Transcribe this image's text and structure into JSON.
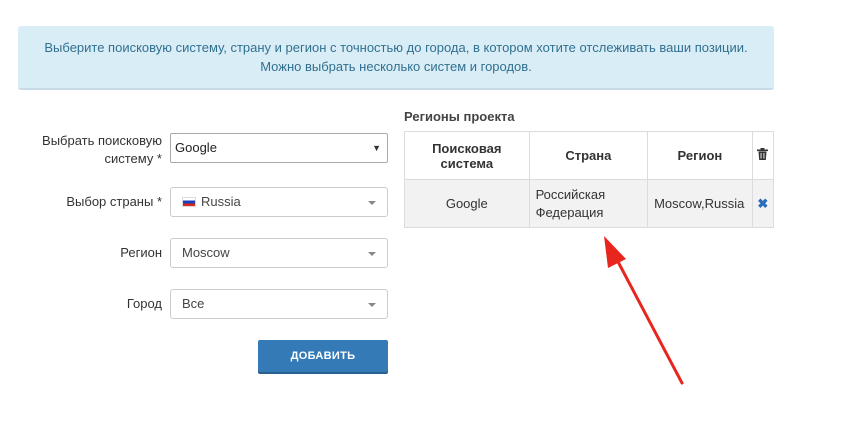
{
  "notice": {
    "line1": "Выберите поисковую систему, страну и регион с точностью до города, в котором хотите отслеживать ваши позиции.",
    "line2": "Можно выбрать несколько систем и городов."
  },
  "form": {
    "engine": {
      "label_line1": "Выбрать поисковую",
      "label_line2": "систему *",
      "value": "Google"
    },
    "country": {
      "label": "Выбор страны *",
      "value": "Russia"
    },
    "region": {
      "label": "Регион",
      "value": "Moscow"
    },
    "city": {
      "label": "Город",
      "value": "Все"
    },
    "add_button": "ДОБАВИТЬ"
  },
  "table": {
    "title": "Регионы проекта",
    "headers": {
      "engine_line1": "Поисковая",
      "engine_line2": "система",
      "country": "Страна",
      "region": "Регион"
    },
    "rows": [
      {
        "engine": "Google",
        "country_line1": "Российская",
        "country_line2": "Федерация",
        "region": "Moscow,Russia"
      }
    ]
  },
  "icons": {
    "delete": "close-icon",
    "trash": "trash-icon",
    "flag": "russia-flag-icon"
  },
  "colors": {
    "notice_bg": "#d9edf7",
    "button": "#337ab7",
    "arrow": "#e8261f"
  }
}
